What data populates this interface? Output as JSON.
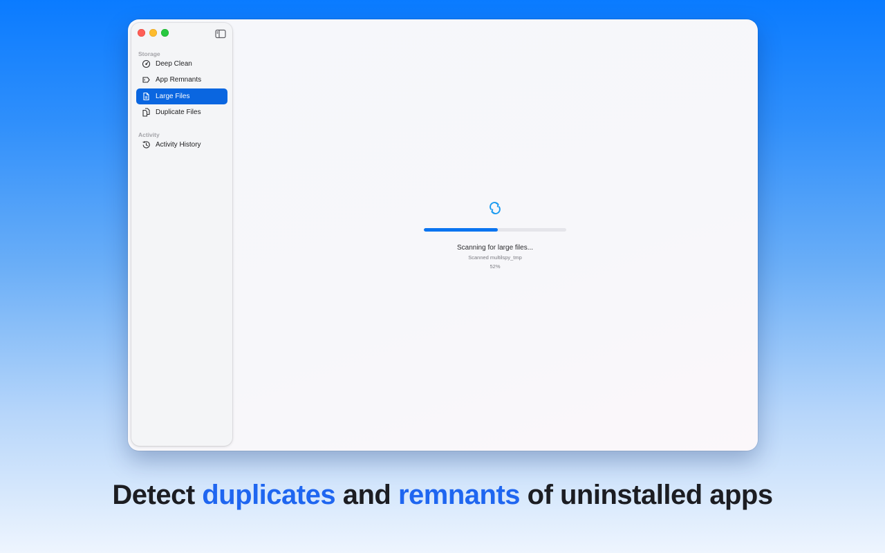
{
  "window": {
    "traffic_lights": [
      "close",
      "minimize",
      "maximize"
    ],
    "sidebar_toggle_icon": "sidebar-left-icon"
  },
  "sidebar": {
    "sections": [
      {
        "label": "Storage",
        "items": [
          {
            "label": "Deep Clean",
            "icon": "gauge-icon",
            "active": false
          },
          {
            "label": "App Remnants",
            "icon": "app-remnants-icon",
            "active": false
          },
          {
            "label": "Large Files",
            "icon": "document-icon",
            "active": true
          },
          {
            "label": "Duplicate Files",
            "icon": "duplicate-documents-icon",
            "active": false
          }
        ]
      },
      {
        "label": "Activity",
        "items": [
          {
            "label": "Activity History",
            "icon": "clock-history-icon",
            "active": false
          }
        ]
      }
    ]
  },
  "scan": {
    "icon": "sync-arrows-icon",
    "title": "Scanning for large files...",
    "status": "Scanned multilspy_tmp",
    "percent_label": "52%",
    "progress": 0.52
  },
  "headline": {
    "part1": "Detect ",
    "highlight1": "duplicates",
    "part2": " and ",
    "highlight2": "remnants",
    "part3": " of uninstalled apps"
  },
  "colors": {
    "accent": "#0a66e0",
    "progress": "#0a74f0",
    "highlight": "#1f66f0",
    "spinner": "#1a9af0"
  }
}
